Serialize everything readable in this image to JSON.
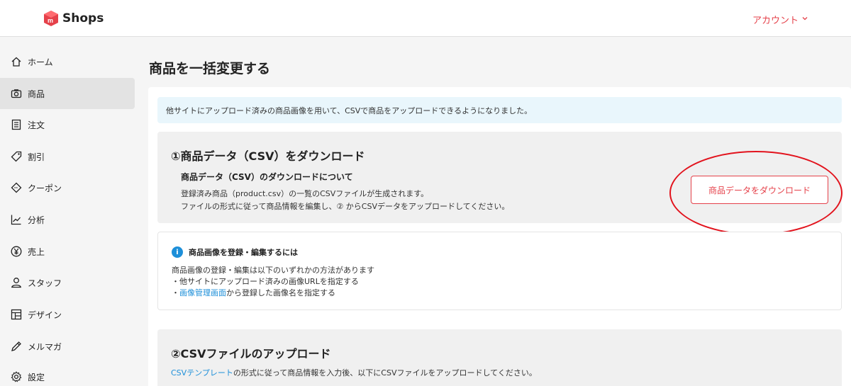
{
  "header": {
    "logo_text": "Shops",
    "account_label": "アカウント"
  },
  "sidebar": {
    "items": [
      {
        "label": "ホーム",
        "icon": "home-icon"
      },
      {
        "label": "商品",
        "icon": "camera-icon",
        "active": true
      },
      {
        "label": "注文",
        "icon": "list-icon"
      },
      {
        "label": "割引",
        "icon": "tag-icon"
      },
      {
        "label": "クーポン",
        "icon": "coupon-icon"
      },
      {
        "label": "分析",
        "icon": "chart-icon"
      },
      {
        "label": "売上",
        "icon": "yen-icon"
      },
      {
        "label": "スタッフ",
        "icon": "user-icon"
      },
      {
        "label": "デザイン",
        "icon": "grid-icon"
      },
      {
        "label": "メルマガ",
        "icon": "pen-icon"
      },
      {
        "label": "設定",
        "icon": "gear-icon"
      }
    ]
  },
  "main": {
    "page_title": "商品を一括変更する",
    "notice": "他サイトにアップロード済みの商品画像を用いて、CSVで商品をアップロードできるようになりました。",
    "section1": {
      "title": "①商品データ（CSV）をダウンロード",
      "subtitle": "商品データ（CSV）のダウンロードについて",
      "line1": "登録済み商品（product.csv）の一覧のCSVファイルが生成されます。",
      "line2": "ファイルの形式に従って商品情報を編集し、② からCSVデータをアップロードしてください。",
      "button_label": "商品データをダウンロード"
    },
    "info": {
      "title": "商品画像を登録・編集するには",
      "line1": "商品画像の登録・編集は以下のいずれかの方法があります",
      "line2": "・他サイトにアップロード済みの画像URLを指定する",
      "line3_prefix": "・",
      "line3_link": "画像管理画面",
      "line3_suffix": "から登録した画像名を指定する"
    },
    "section2": {
      "title": "②CSVファイルのアップロード",
      "line_link": "CSVテンプレート",
      "line_suffix": "の形式に従って商品情報を入力後、以下にCSVファイルをアップロードしてください。"
    }
  },
  "colors": {
    "accent": "#e5414a",
    "link": "#1d8fd9",
    "annotation": "#e2131d"
  }
}
